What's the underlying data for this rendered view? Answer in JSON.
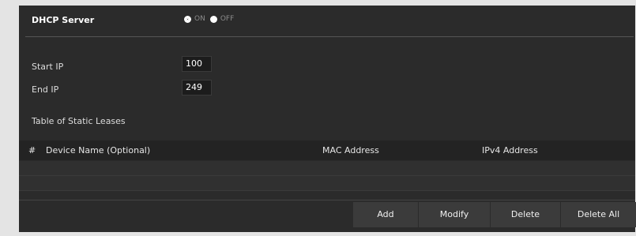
{
  "dhcp": {
    "title": "DHCP Server",
    "on_label": "ON",
    "off_label": "OFF"
  },
  "fields": {
    "start_ip_label": "Start IP",
    "start_ip_value": "100",
    "end_ip_label": "End IP",
    "end_ip_value": "249"
  },
  "table": {
    "title": "Table of Static Leases",
    "columns": [
      "#",
      "Device Name (Optional)",
      "MAC Address",
      "IPv4 Address"
    ]
  },
  "buttons": {
    "add": "Add",
    "modify": "Modify",
    "delete": "Delete",
    "delete_all": "Delete All"
  }
}
